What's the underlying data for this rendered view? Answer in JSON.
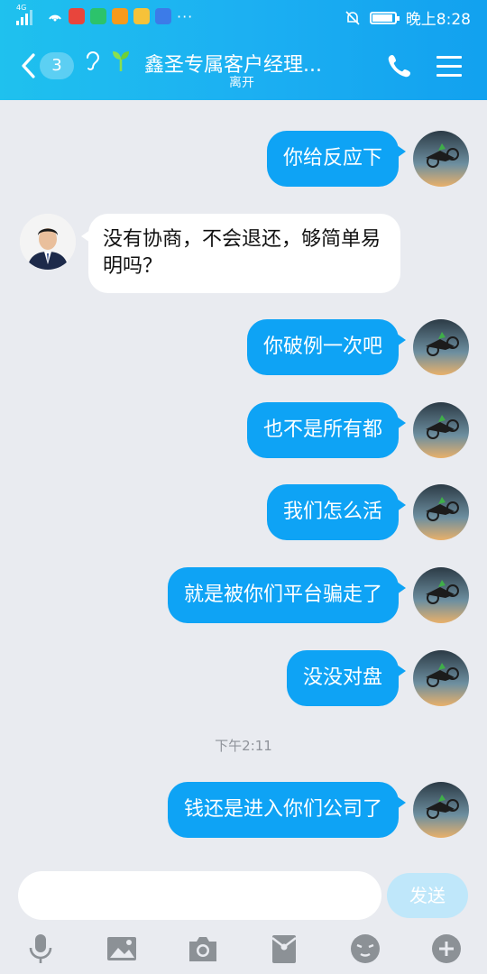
{
  "status": {
    "network": "4G",
    "time": "晚上8:28",
    "dots": "···",
    "battery_level": 0.85
  },
  "header": {
    "badge_count": "3",
    "title": "鑫圣专属客户经理...",
    "subtitle": "离开"
  },
  "messages": [
    {
      "from": "me",
      "text": "你给反应下"
    },
    {
      "from": "them",
      "text": "没有协商，不会退还，够简单易明吗？"
    },
    {
      "from": "me",
      "text": "你破例一次吧"
    },
    {
      "from": "me",
      "text": "也不是所有都"
    },
    {
      "from": "me",
      "text": "我们怎么活"
    },
    {
      "from": "me",
      "text": "就是被你们平台骗走了"
    },
    {
      "from": "me",
      "text": "没没对盘"
    },
    {
      "from": "me",
      "text": "钱还是进入你们公司了"
    }
  ],
  "timestamp": "下午2:11",
  "input": {
    "value": "",
    "send_label": "发送"
  },
  "colors": {
    "accent": "#0ea3f5",
    "header": "#1cb0f2",
    "background": "#e9ebf0",
    "send_disabled": "#bfe7fa"
  },
  "toolbar_icons": [
    "microphone-icon",
    "image-icon",
    "camera-icon",
    "red-packet-icon",
    "emoji-icon",
    "plus-icon"
  ]
}
